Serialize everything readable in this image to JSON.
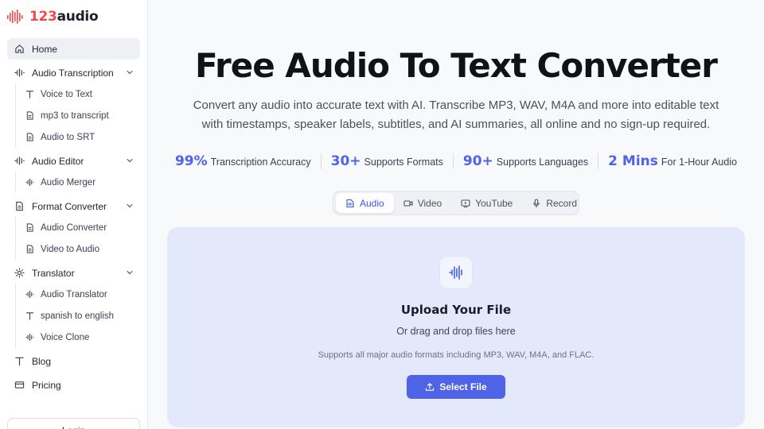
{
  "brand": {
    "num": "123",
    "word": "audio",
    "logo_color": "#f04a4a",
    "logo_icon": "sound-wave-logo-icon"
  },
  "sidebar": {
    "home": "Home",
    "groups": [
      {
        "label": "Audio Transcription",
        "icon": "sound-wave-icon",
        "items": [
          {
            "label": "Voice to Text",
            "icon": "text-t-icon"
          },
          {
            "label": "mp3 to transcript",
            "icon": "document-icon"
          },
          {
            "label": "Audio to SRT",
            "icon": "document-icon"
          }
        ]
      },
      {
        "label": "Audio Editor",
        "icon": "sound-wave-icon",
        "items": [
          {
            "label": "Audio Merger",
            "icon": "sound-wave-icon"
          }
        ]
      },
      {
        "label": "Format Converter",
        "icon": "document-icon",
        "items": [
          {
            "label": "Audio Converter",
            "icon": "document-icon"
          },
          {
            "label": "Video to Audio",
            "icon": "document-icon"
          }
        ]
      },
      {
        "label": "Translator",
        "icon": "sparkle-icon",
        "items": [
          {
            "label": "Audio Translator",
            "icon": "sound-wave-icon"
          },
          {
            "label": "spanish to english",
            "icon": "text-t-icon"
          },
          {
            "label": "Voice Clone",
            "icon": "sound-wave-icon"
          }
        ]
      }
    ],
    "blog": "Blog",
    "pricing": "Pricing",
    "login": "Login"
  },
  "hero": {
    "title": "Free Audio To Text Converter",
    "subtitle_line1": "Convert any audio into accurate text with AI. Transcribe MP3, WAV, M4A and more into editable text",
    "subtitle_line2": "with timestamps, speaker labels, subtitles, and AI summaries, all online and no sign-up required."
  },
  "stats": [
    {
      "value": "99%",
      "label": "Transcription Accuracy"
    },
    {
      "value": "30+",
      "label": "Supports Formats"
    },
    {
      "value": "90+",
      "label": "Supports Languages"
    },
    {
      "value": "2 Mins",
      "label": "For 1-Hour Audio"
    }
  ],
  "tabs": [
    {
      "label": "Audio",
      "icon": "audio-file-icon",
      "active": true
    },
    {
      "label": "Video",
      "icon": "video-camera-icon",
      "active": false
    },
    {
      "label": "YouTube",
      "icon": "youtube-icon",
      "active": false
    },
    {
      "label": "Record",
      "icon": "microphone-icon",
      "active": false
    }
  ],
  "upload": {
    "title": "Upload Your File",
    "drag_text": "Or drag and drop files here",
    "formats_text": "Supports all major audio formats including MP3, WAV, M4A, and FLAC.",
    "button_label": "Select File"
  },
  "colors": {
    "accent": "#4f63e6",
    "upload_bg": "#e4e8fb",
    "active_nav_bg": "#eef0f4"
  }
}
